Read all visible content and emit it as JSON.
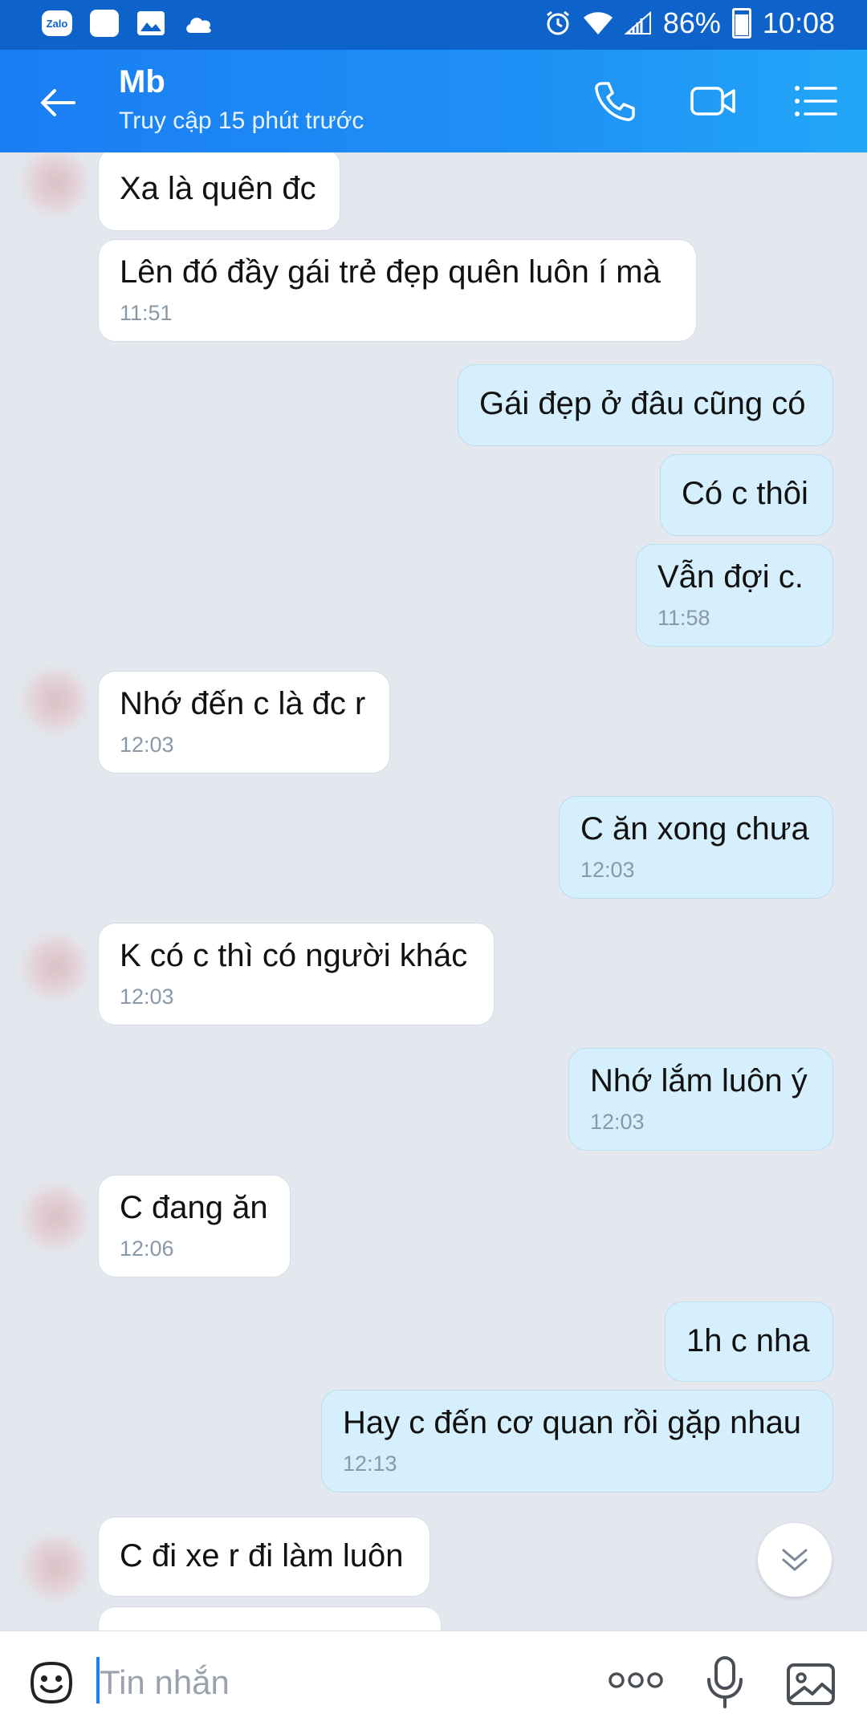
{
  "status_bar": {
    "app_badge": "Zalo",
    "battery": "86%",
    "time": "10:08"
  },
  "header": {
    "title": "Mb",
    "subtitle": "Truy cập 15 phút trước"
  },
  "messages": [
    {
      "dir": "in",
      "text": "Xa là quên đc",
      "time": ""
    },
    {
      "dir": "in",
      "text": "Lên đó đầy gái trẻ đẹp quên luôn í mà",
      "time": "11:51"
    },
    {
      "dir": "out",
      "text": "Gái đẹp ở đâu cũng có",
      "time": ""
    },
    {
      "dir": "out",
      "text": "Có c thôi",
      "time": ""
    },
    {
      "dir": "out",
      "text": "Vẫn đợi c.",
      "time": "11:58"
    },
    {
      "dir": "in",
      "text": "Nhớ đến c là đc r",
      "time": "12:03"
    },
    {
      "dir": "out",
      "text": "C ăn xong chưa",
      "time": "12:03"
    },
    {
      "dir": "in",
      "text": "K có c thì có người khác",
      "time": "12:03"
    },
    {
      "dir": "out",
      "text": "Nhớ lắm luôn ý",
      "time": "12:03"
    },
    {
      "dir": "in",
      "text": "C đang ăn",
      "time": "12:06"
    },
    {
      "dir": "out",
      "text": "1h c nha",
      "time": ""
    },
    {
      "dir": "out",
      "text": "Hay c đến cơ quan rồi gặp nhau",
      "time": "12:13"
    },
    {
      "dir": "in",
      "text": "C đi xe r đi làm luôn",
      "time": ""
    }
  ],
  "input": {
    "placeholder": "Tin nhắn"
  },
  "icons": {
    "back": "arrow-left-icon",
    "call": "phone-icon",
    "video": "video-camera-icon",
    "menu": "list-menu-icon",
    "sticker": "sticker-smiley-icon",
    "more": "more-dots-icon",
    "mic": "microphone-icon",
    "gallery": "image-gallery-icon",
    "scroll": "chevron-double-down-icon"
  },
  "colors": {
    "header": "#1a7ef4",
    "incoming_bubble": "#ffffff",
    "outgoing_bubble": "#d5effd",
    "chat_background": "#e3e8ef"
  }
}
